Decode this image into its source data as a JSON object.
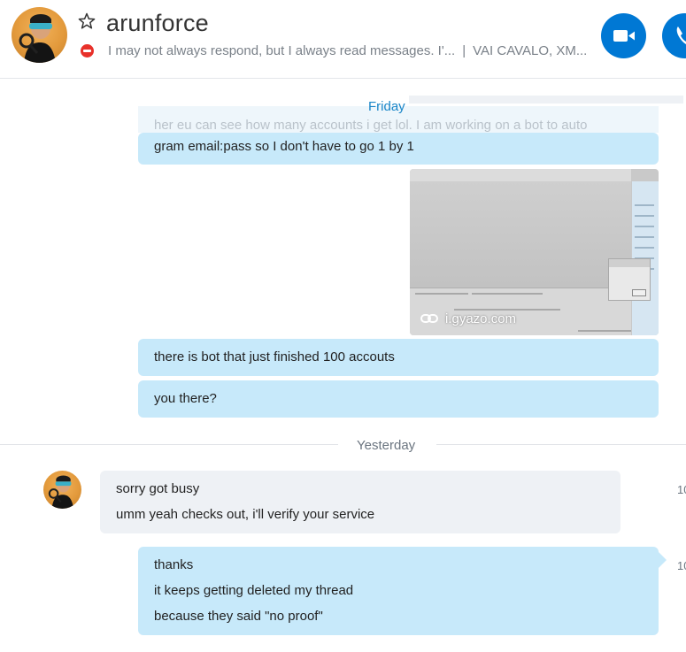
{
  "contact": {
    "name": "arunforce",
    "mood_message": "I may not always respond, but I always read messages. I'...",
    "mood_separator": "|",
    "location_text": "VAI CAVALO, XM..."
  },
  "icons": {
    "favorite": "star-icon",
    "status": "do-not-disturb-icon",
    "video_call": "video-camera-icon",
    "audio_call": "phone-icon",
    "link": "link-icon"
  },
  "colors": {
    "accent": "#0078d4",
    "outgoing_bubble": "#c7e9fa",
    "incoming_bubble": "#eef1f5",
    "status_dnd": "#e8312a",
    "day_label_today": "#1a86c8"
  },
  "conversation": {
    "day_friday": "Friday",
    "faded_partial_text": "her eu can see how many accounts i get lol. I am working on a bot to auto",
    "msg_gram_email": "gram email:pass so I don't have to go 1 by 1",
    "image_source": "i.gyazo.com",
    "msg_bot_finished": "there is bot that just finished 100 accouts",
    "msg_you_there": "you there?",
    "day_yesterday": "Yesterday",
    "incoming": [
      "sorry got busy",
      "umm yeah checks out, i'll verify your service"
    ],
    "incoming_time": "10",
    "outgoing_final": [
      "thanks",
      "it keeps getting deleted my thread",
      "because they said \"no proof\""
    ],
    "outgoing_time": "10"
  }
}
